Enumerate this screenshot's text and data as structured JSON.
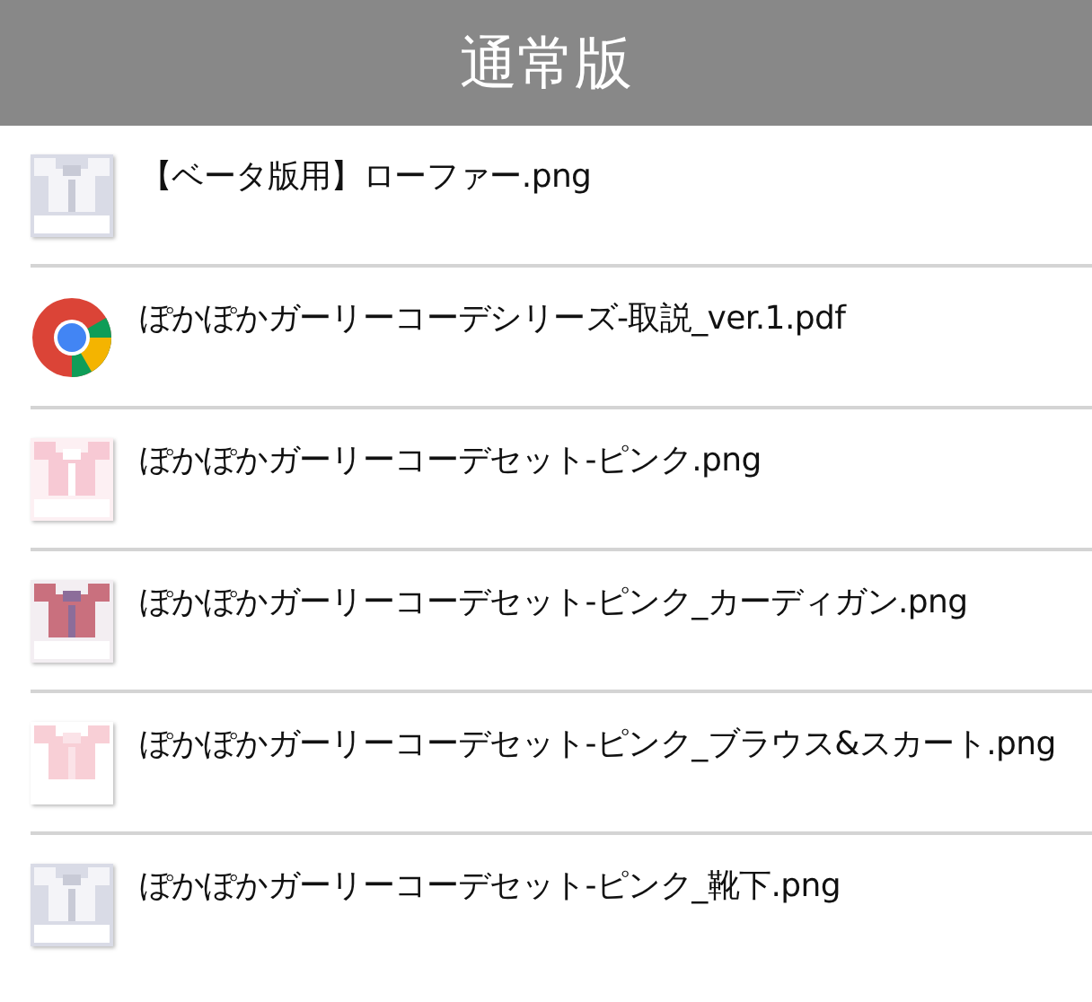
{
  "header": {
    "title": "通常版"
  },
  "files": [
    {
      "name": "【ベータ版用】ローファー.png"
    },
    {
      "name": "ぽかぽかガーリーコーデシリーズ-取説_ver.1.pdf",
      "kind": "pdf"
    },
    {
      "name": "ぽかぽかガーリーコーデセット-ピンク.png"
    },
    {
      "name": "ぽかぽかガーリーコーデセット-ピンク_カーディガン.png"
    },
    {
      "name": "ぽかぽかガーリーコーデセット-ピンク_ブラウス&スカート.png"
    },
    {
      "name": "ぽかぽかガーリーコーデセット-ピンク_靴下.png"
    }
  ]
}
